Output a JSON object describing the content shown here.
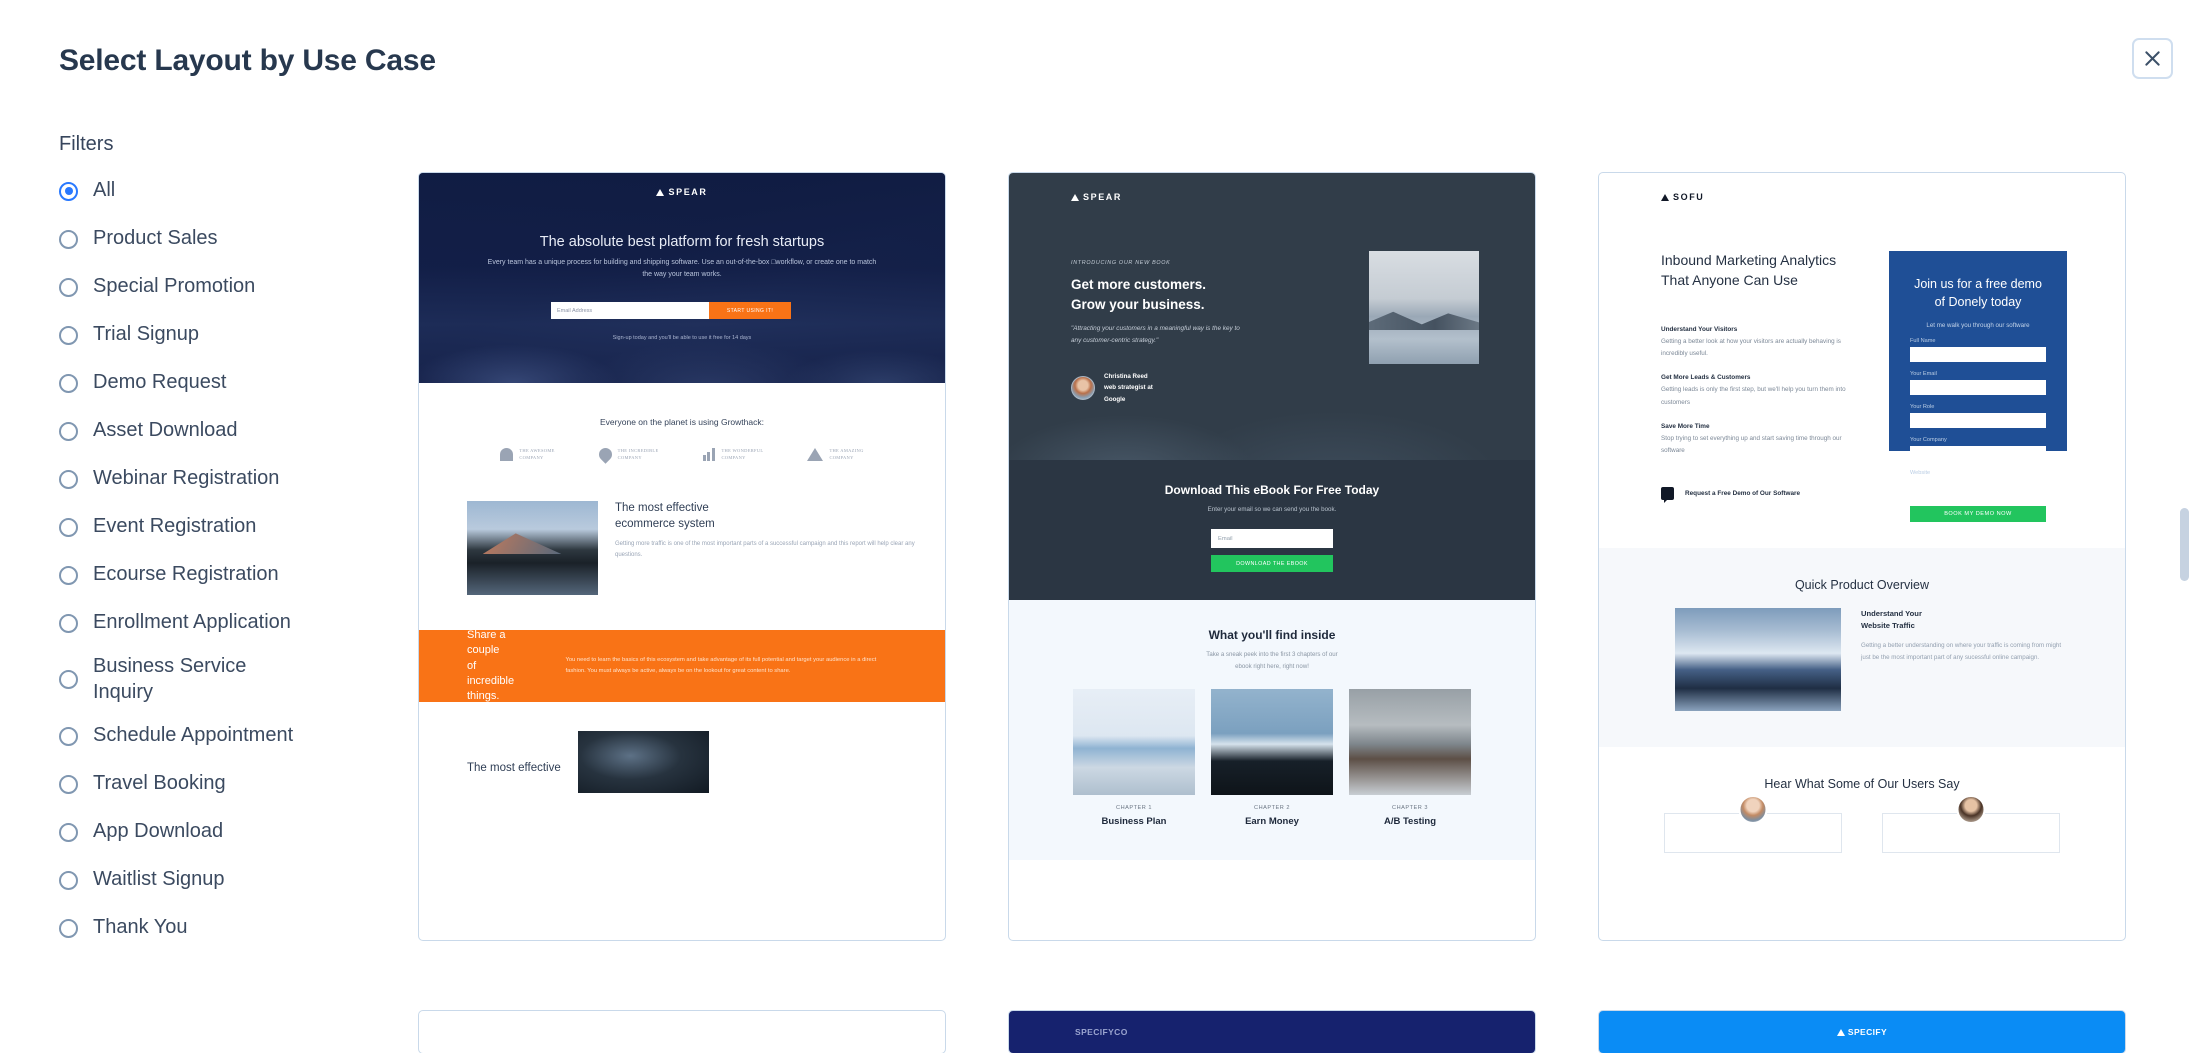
{
  "header": {
    "title": "Select Layout by Use Case",
    "close_icon": "close-icon"
  },
  "filters": {
    "title": "Filters",
    "selected": "All",
    "items": [
      {
        "label": "All",
        "checked": true
      },
      {
        "label": "Product Sales",
        "checked": false
      },
      {
        "label": "Special Promotion",
        "checked": false
      },
      {
        "label": "Trial Signup",
        "checked": false
      },
      {
        "label": "Demo Request",
        "checked": false
      },
      {
        "label": "Asset Download",
        "checked": false
      },
      {
        "label": "Webinar Registration",
        "checked": false
      },
      {
        "label": "Event Registration",
        "checked": false
      },
      {
        "label": "Ecourse Registration",
        "checked": false
      },
      {
        "label": "Enrollment Application",
        "checked": false
      },
      {
        "label": "Business Service Inquiry",
        "checked": false
      },
      {
        "label": "Schedule Appointment",
        "checked": false
      },
      {
        "label": "Travel Booking",
        "checked": false
      },
      {
        "label": "App Download",
        "checked": false
      },
      {
        "label": "Waitlist Signup",
        "checked": false
      },
      {
        "label": "Thank You",
        "checked": false
      }
    ]
  },
  "templates": {
    "card1": {
      "logo": "SPEAR",
      "hero_heading": "The absolute best platform for fresh startups",
      "hero_sub": "Every team has a unique process for building and shipping software. Use an out-of-the-box □workflow, or create one to match the way your team works.",
      "email_placeholder": "Email Address",
      "cta": "START USING IT!",
      "note": "Sign-up today and you'll be able to use it free for 14 days",
      "logos_title": "Everyone on the planet is using Growthack:",
      "logos": [
        {
          "line1": "THE AWESOME",
          "line2": "COMPANY"
        },
        {
          "line1": "THE INCREDIBLE",
          "line2": "COMPANY"
        },
        {
          "line1": "THE WONDERFUL",
          "line2": "COMPANY"
        },
        {
          "line1": "THE AMAZING",
          "line2": "COMPANY"
        }
      ],
      "feature_heading": "The most effective\necommerce system",
      "feature_body": "Getting more traffic is one of the most important parts of a successful campaign and this report will help clear any questions.",
      "band_heading": "Share a couple\nof incredible things.",
      "band_body": "You need to learn the basics of this ecosystem and take advantage of its full potential and target your audience in a direct fashion. You must always be active, always be on the lookout for great content to share.",
      "bottom_heading": "The most effective"
    },
    "card2": {
      "logo": "SPEAR",
      "eyebrow": "INTRODUCING OUR NEW BOOK",
      "heading": "Get more customers.\nGrow your business.",
      "quote": "\"Attracting your customers in a meaningful way is the key to any customer-centric strategy.\"",
      "author_name": "Christina Reed",
      "author_role": "web strategist at",
      "author_company": "Google",
      "form_heading": "Download This eBook For Free Today",
      "form_sub": "Enter your email so we can send you the book.",
      "email_placeholder": "Email",
      "form_cta": "DOWNLOAD THE EBOOK",
      "inside_heading": "What you'll find inside",
      "inside_sub": "Take a sneak peek into the first 3 chapters of our\nebook right here, right now!",
      "chapters": [
        {
          "label": "CHAPTER 1",
          "title": "Business Plan"
        },
        {
          "label": "CHAPTER 2",
          "title": "Earn Money"
        },
        {
          "label": "CHAPTER 3",
          "title": "A/B Testing"
        }
      ]
    },
    "card3": {
      "logo": "SOFU",
      "heading": "Inbound Marketing Analytics\nThat Anyone Can Use",
      "blocks": [
        {
          "title": "Understand Your Visitors",
          "body": "Getting a better look at how your visitors are actually behaving is incredibly useful."
        },
        {
          "title": "Get More Leads & Customers",
          "body": "Getting leads is only the first step, but we'll help you turn them into customers"
        },
        {
          "title": "Save More Time",
          "body": "Stop trying to set everything up and start saving time through our software"
        }
      ],
      "demo_link": "Request a Free Demo of Our Software",
      "panel_heading": "Join us for a free demo\nof Donely today",
      "panel_sub": "Let me walk you through our software",
      "fields": [
        "Full Name",
        "Your Email",
        "Your Role",
        "Your Company",
        "Website"
      ],
      "panel_cta": "BOOK MY DEMO NOW",
      "overview_heading": "Quick Product Overview",
      "overview_title": "Understand Your\nWebsite Traffic",
      "overview_body": "Getting a better understanding on where your traffic is coming from might just be the most important part of any sucessful online campaign.",
      "users_heading": "Hear What Some of Our Users Say"
    },
    "card4": {
      "logo": ""
    },
    "card5": {
      "logo": "SPECIFY",
      "logo_suffix": "CO"
    },
    "card6": {
      "logo": "SPECIFY"
    }
  },
  "colors": {
    "accent": "#2979ff",
    "title": "#27384e",
    "orange": "#f97316",
    "green": "#22c55e",
    "panel_blue": "#1f4f96",
    "card_border": "#c9d9ea"
  }
}
